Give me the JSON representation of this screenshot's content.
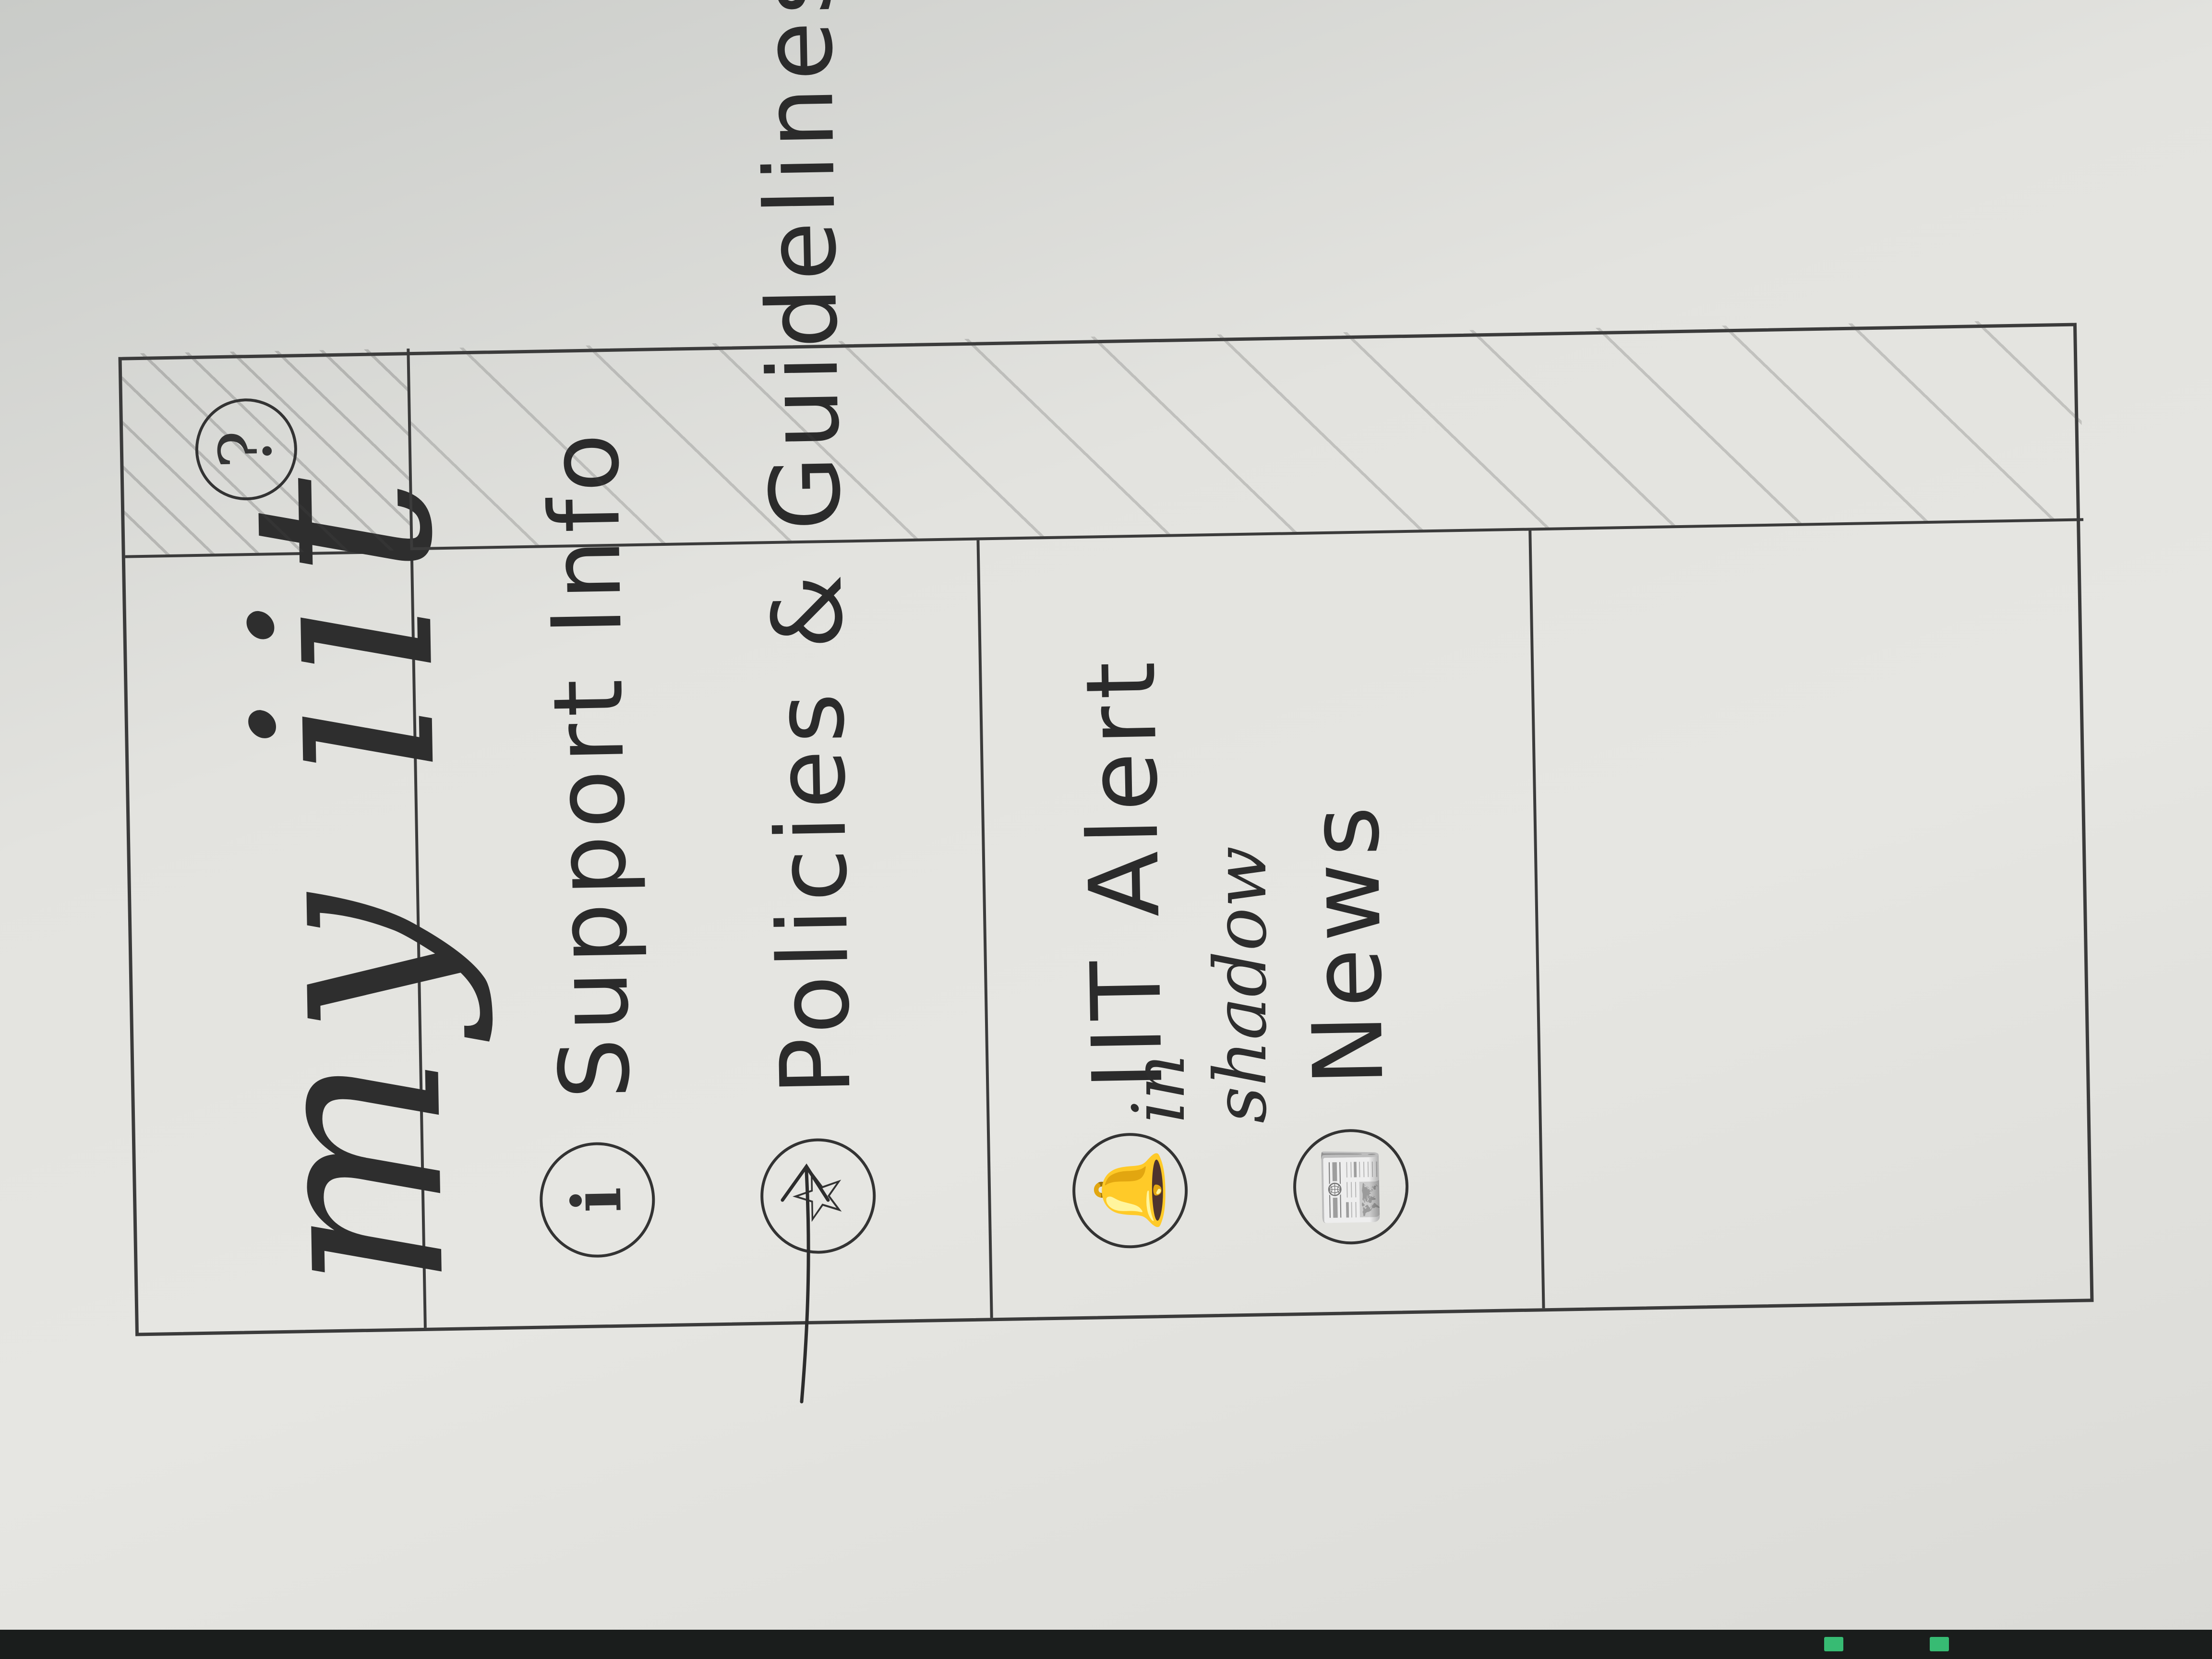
{
  "app": {
    "title": "my iit"
  },
  "help": {
    "icon": "question-icon",
    "glyph": "?"
  },
  "menu": {
    "items": [
      {
        "label": "Support Info",
        "icon": "info-icon",
        "glyph": "ℹ"
      },
      {
        "label": "Policies & Guidelines",
        "icon": "star-icon",
        "glyph": "☆"
      },
      {
        "label": "IIT Alert",
        "icon": "bell-icon",
        "glyph": "🔔"
      },
      {
        "label": "News",
        "icon": "newspaper-icon",
        "glyph": "📰"
      }
    ]
  },
  "annotation": {
    "text": "in\nshadow"
  },
  "colors": {
    "pencil": "#3b3b3b",
    "paper": "#e3e3df"
  }
}
